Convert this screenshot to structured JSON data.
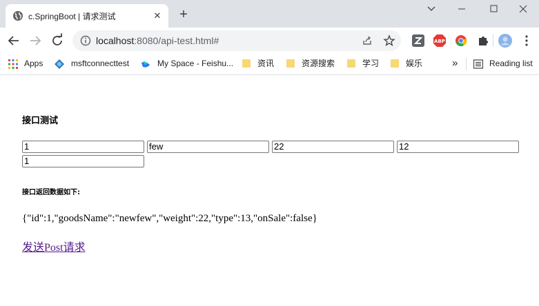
{
  "browser": {
    "tab_title": "c.SpringBoot | 请求测试",
    "url_host": "localhost",
    "url_rest": ":8080/api-test.html#",
    "bookmarks": [
      {
        "label": "Apps"
      },
      {
        "label": "msftconnecttest"
      },
      {
        "label": "My Space - Feishu..."
      },
      {
        "label": "资讯"
      },
      {
        "label": "资源搜索"
      },
      {
        "label": "学习"
      },
      {
        "label": "娱乐"
      }
    ],
    "reading_list": "Reading list",
    "more": "»"
  },
  "page": {
    "title": "接口测试",
    "inputs": [
      "1",
      "few",
      "22",
      "12",
      "1"
    ],
    "result_heading": "接口返回数据如下:",
    "result_text": "{\"id\":1,\"goodsName\":\"newfew\",\"weight\":22,\"type\":13,\"onSale\":false}",
    "post_link": "发送Post请求"
  },
  "colors": {
    "tabstrip": "#dee1e6",
    "link_visited": "#551a8b"
  }
}
